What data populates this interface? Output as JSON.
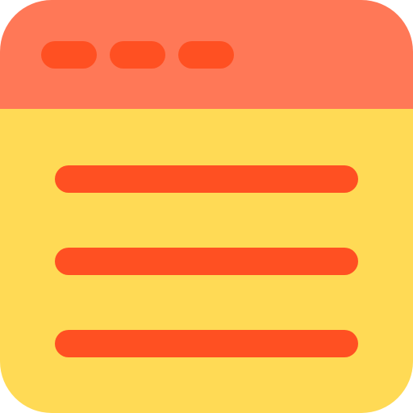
{
  "colors": {
    "titlebar": "#FF7857",
    "body": "#FFDA55",
    "accent": "#FF5022",
    "page_background": "#FFFFFF"
  },
  "icon": {
    "name": "browser-window-icon",
    "titlebar_dots": 3,
    "content_lines": 3
  }
}
